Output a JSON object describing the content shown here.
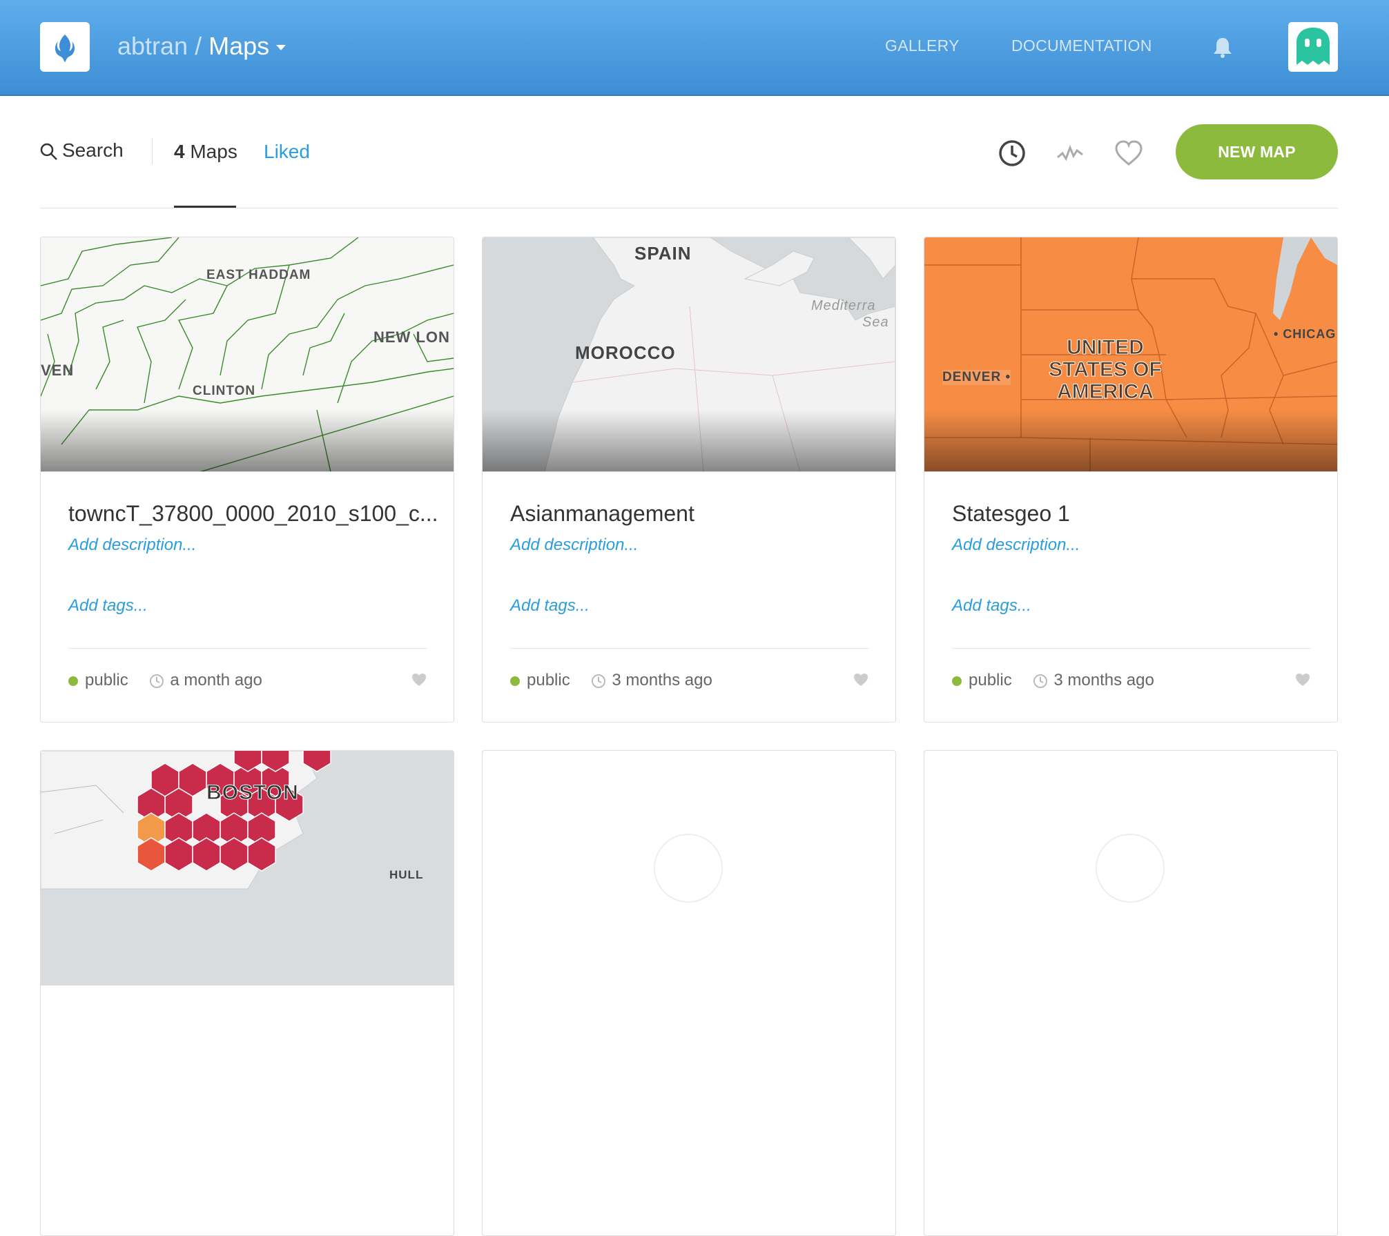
{
  "header": {
    "user": "abtran /",
    "section": "Maps",
    "nav": [
      "GALLERY",
      "DOCUMENTATION"
    ]
  },
  "toolbar": {
    "search_label": "Search",
    "maps_count": "4",
    "maps_label": "Maps",
    "liked_label": "Liked",
    "new_map_label": "NEW MAP"
  },
  "cards": [
    {
      "title": "towncT_37800_0000_2010_s100_c...",
      "description": "Add description...",
      "tags": "Add tags...",
      "privacy": "public",
      "updated": "a month ago",
      "map_labels": [
        "EAST HADDAM",
        "NEW LON",
        "VEN",
        "CLINTON"
      ]
    },
    {
      "title": "Asianmanagement",
      "description": "Add description...",
      "tags": "Add tags...",
      "privacy": "public",
      "updated": "3 months ago",
      "map_labels": [
        "SPAIN",
        "MOROCCO",
        "Mediterra",
        "Sea"
      ]
    },
    {
      "title": "Statesgeo 1",
      "description": "Add description...",
      "tags": "Add tags...",
      "privacy": "public",
      "updated": "3 months ago",
      "map_labels": [
        "UNITED",
        "STATES OF",
        "AMERICA",
        "DENVER",
        "CHICAG"
      ]
    },
    {
      "map_labels": [
        "BOSTON",
        "HULL"
      ]
    }
  ],
  "colors": {
    "header": "#4a9de3",
    "accent_green": "#8cba3c",
    "link_blue": "#2a9de0",
    "choropleth_orange": "#f78c45",
    "hex_red": "#c92b4a"
  }
}
